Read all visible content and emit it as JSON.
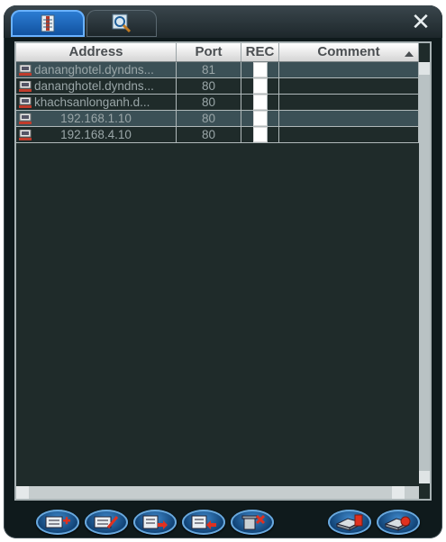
{
  "tabs": [
    {
      "name": "device-list-tab",
      "icon": "device-list-icon",
      "active": true
    },
    {
      "name": "search-tab",
      "icon": "search-icon",
      "active": false
    }
  ],
  "close_icon": "close-icon",
  "table": {
    "headers": {
      "address": "Address",
      "port": "Port",
      "rec": "REC",
      "comment": "Comment"
    },
    "rows": [
      {
        "address": "dananghotel.dyndns...",
        "port": "81",
        "rec": false,
        "comment": "",
        "selected": true
      },
      {
        "address": "dananghotel.dyndns...",
        "port": "80",
        "rec": false,
        "comment": "",
        "selected": false
      },
      {
        "address": "khachsanlonganh.d...",
        "port": "80",
        "rec": false,
        "comment": "",
        "selected": false
      },
      {
        "address": "192.168.1.10",
        "port": "80",
        "rec": false,
        "comment": "",
        "selected": true
      },
      {
        "address": "192.168.4.10",
        "port": "80",
        "rec": false,
        "comment": "",
        "selected": false
      }
    ]
  },
  "toolbar": {
    "buttons": [
      {
        "icon": "add-device-icon"
      },
      {
        "icon": "edit-device-icon"
      },
      {
        "icon": "export-list-icon"
      },
      {
        "icon": "import-list-icon"
      },
      {
        "icon": "delete-device-icon"
      },
      {
        "icon": "connect-icon"
      },
      {
        "icon": "disconnect-icon"
      }
    ]
  },
  "colors": {
    "accent": "#1f6fc4",
    "panel": "#1f2b2a",
    "text": "#9aa6a8"
  }
}
